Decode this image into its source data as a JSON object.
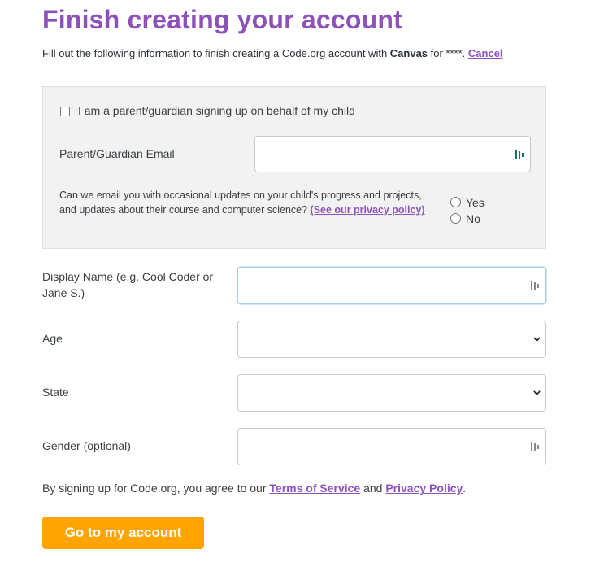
{
  "page": {
    "title": "Finish creating your account",
    "intro": {
      "prefix": "Fill out the following information to finish creating a Code.org account with ",
      "provider": "Canvas",
      "for_text": " for ****.",
      "cancel_label": "Cancel"
    }
  },
  "parent_section": {
    "checkbox_label": "I am a parent/guardian signing up on behalf of my child",
    "checkbox_checked": false,
    "email_label": "Parent/Guardian Email",
    "email_value": "",
    "consent_text": "Can we email you with occasional updates on your child's progress and projects, and updates about their course and computer science?",
    "privacy_link": "(See our privacy policy)",
    "options": [
      {
        "label": "Yes",
        "selected": false
      },
      {
        "label": "No",
        "selected": false
      }
    ]
  },
  "form": {
    "display_name": {
      "label": "Display Name (e.g. Cool Coder or Jane S.)",
      "value": ""
    },
    "age": {
      "label": "Age",
      "value": ""
    },
    "state": {
      "label": "State",
      "value": ""
    },
    "gender": {
      "label": "Gender (optional)",
      "value": ""
    }
  },
  "terms": {
    "prefix": "By signing up for Code.org, you agree to our ",
    "tos_label": "Terms of Service",
    "and_text": " and ",
    "privacy_label": "Privacy Policy",
    "suffix": "."
  },
  "submit_label": "Go to my account",
  "colors": {
    "brand_purple": "#8c52ba",
    "button_orange": "#ffa400",
    "panel_gray": "#f2f2f2"
  },
  "icons": [
    "password-manager-icon",
    "chevron-down-icon"
  ]
}
